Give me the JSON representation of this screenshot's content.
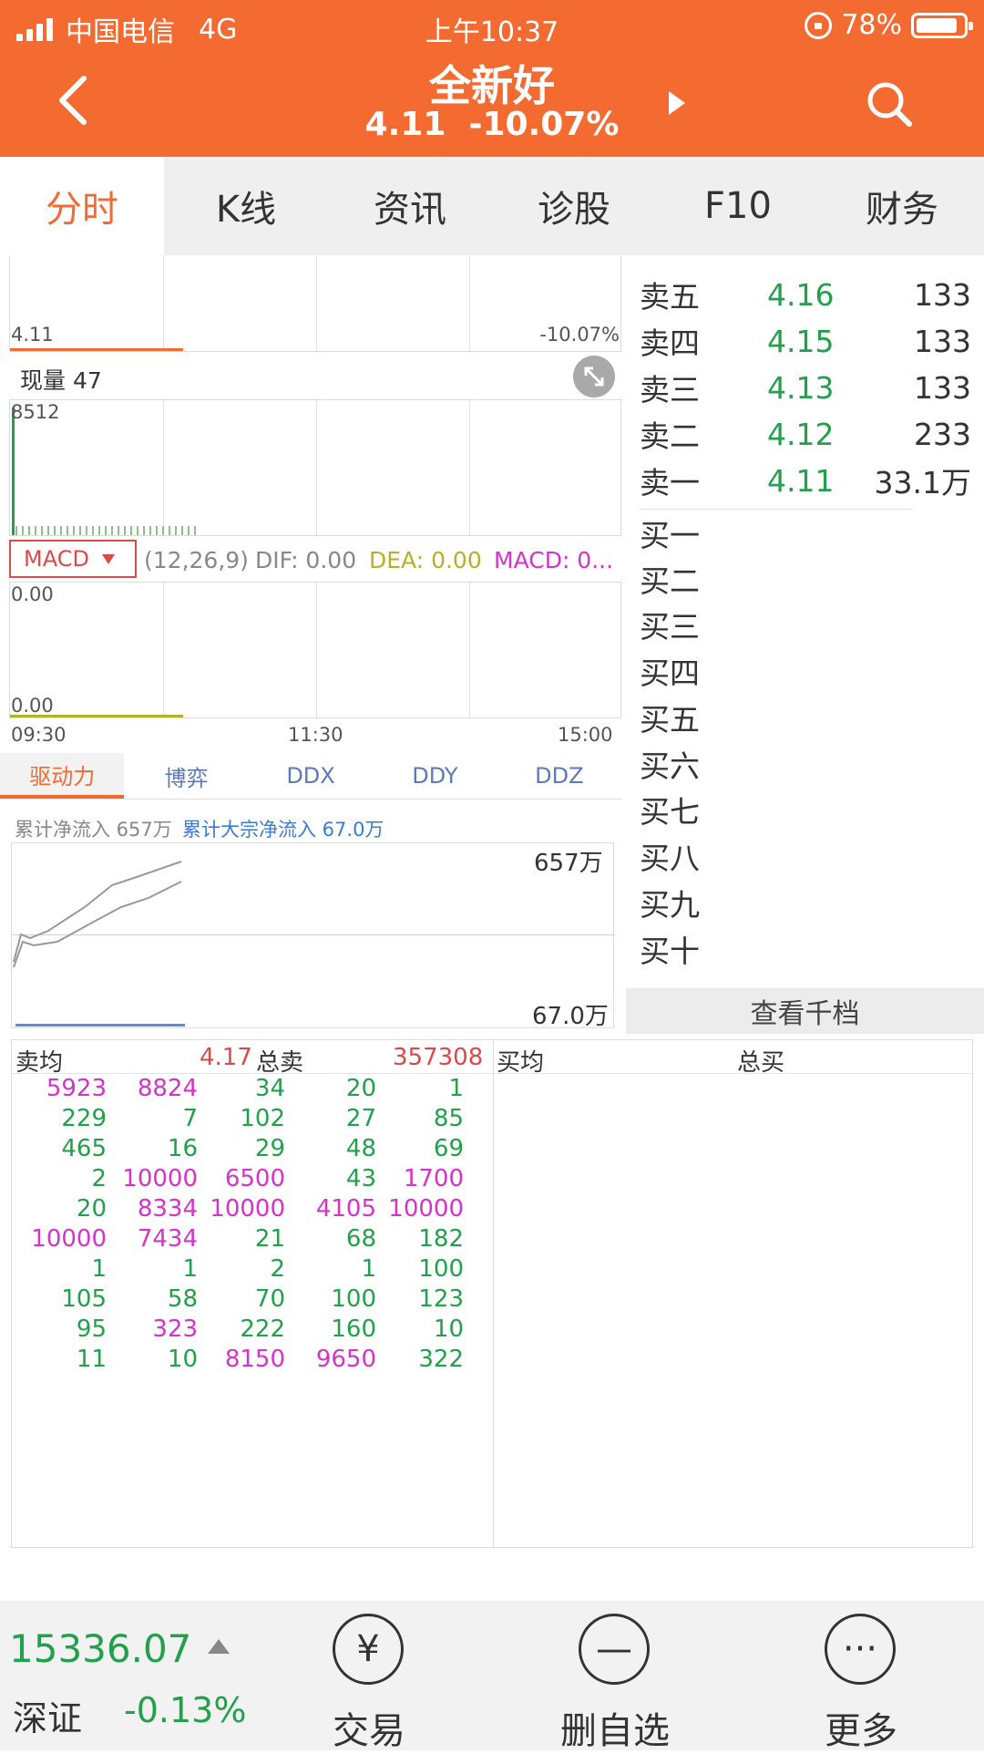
{
  "status_bar": {
    "carrier": "中国电信",
    "network": "4G",
    "time": "上午10:37",
    "battery": "78%"
  },
  "header": {
    "title": "全新好",
    "price": "4.11",
    "change_pct": "-10.07%",
    "accent_color": "#f46b32"
  },
  "tabs": [
    "分时",
    "K线",
    "资讯",
    "诊股",
    "F10",
    "财务"
  ],
  "price_chart": {
    "price_label": "4.11",
    "pct_label": "-10.07%"
  },
  "volume": {
    "label": "现量 47",
    "max_label": "8512"
  },
  "macd": {
    "selector": "MACD",
    "params": "(12,26,9)",
    "dif": "DIF: 0.00",
    "dea": "DEA: 0.00",
    "macd": "MACD: 0...",
    "top_label": "0.00",
    "bottom_label": "0.00"
  },
  "time_axis": [
    "09:30",
    "11:30",
    "15:00"
  ],
  "capital_tabs": [
    "驱动力",
    "博弈",
    "DDX",
    "DDY",
    "DDZ"
  ],
  "capital_flow": {
    "net_inflow": "累计净流入 657万",
    "block_inflow": "累计大宗净流入 67.0万",
    "top_label": "657万",
    "bottom_label": "67.0万"
  },
  "order_book": {
    "sells": [
      {
        "label": "卖五",
        "price": "4.16",
        "volume": "133"
      },
      {
        "label": "卖四",
        "price": "4.15",
        "volume": "133"
      },
      {
        "label": "卖三",
        "price": "4.13",
        "volume": "133"
      },
      {
        "label": "卖二",
        "price": "4.12",
        "volume": "233"
      },
      {
        "label": "卖一",
        "price": "4.11",
        "volume": "33.1万"
      }
    ],
    "buys": [
      "买一",
      "买二",
      "买三",
      "买四",
      "买五",
      "买六",
      "买七",
      "买八",
      "买九",
      "买十"
    ],
    "view_more": "查看千档"
  },
  "transactions": {
    "sell_avg_label": "卖均",
    "sell_avg": "4.17",
    "total_sell_label": "总卖",
    "total_sell": "357308",
    "buy_avg_label": "买均",
    "total_buy_label": "总买",
    "rows": [
      [
        {
          "v": "5923",
          "c": "m"
        },
        {
          "v": "8824",
          "c": "m"
        },
        {
          "v": "34",
          "c": "g"
        },
        {
          "v": "20",
          "c": "g"
        },
        {
          "v": "1",
          "c": "g"
        }
      ],
      [
        {
          "v": "229",
          "c": "g"
        },
        {
          "v": "7",
          "c": "g"
        },
        {
          "v": "102",
          "c": "g"
        },
        {
          "v": "27",
          "c": "g"
        },
        {
          "v": "85",
          "c": "g"
        }
      ],
      [
        {
          "v": "465",
          "c": "g"
        },
        {
          "v": "16",
          "c": "g"
        },
        {
          "v": "29",
          "c": "g"
        },
        {
          "v": "48",
          "c": "g"
        },
        {
          "v": "69",
          "c": "g"
        }
      ],
      [
        {
          "v": "2",
          "c": "g"
        },
        {
          "v": "10000",
          "c": "m"
        },
        {
          "v": "6500",
          "c": "m"
        },
        {
          "v": "43",
          "c": "g"
        },
        {
          "v": "1700",
          "c": "m"
        }
      ],
      [
        {
          "v": "20",
          "c": "g"
        },
        {
          "v": "8334",
          "c": "m"
        },
        {
          "v": "10000",
          "c": "m"
        },
        {
          "v": "4105",
          "c": "m"
        },
        {
          "v": "10000",
          "c": "m"
        }
      ],
      [
        {
          "v": "10000",
          "c": "m"
        },
        {
          "v": "7434",
          "c": "m"
        },
        {
          "v": "21",
          "c": "g"
        },
        {
          "v": "68",
          "c": "g"
        },
        {
          "v": "182",
          "c": "g"
        }
      ],
      [
        {
          "v": "1",
          "c": "g"
        },
        {
          "v": "1",
          "c": "g"
        },
        {
          "v": "2",
          "c": "g"
        },
        {
          "v": "1",
          "c": "g"
        },
        {
          "v": "100",
          "c": "g"
        }
      ],
      [
        {
          "v": "105",
          "c": "g"
        },
        {
          "v": "58",
          "c": "g"
        },
        {
          "v": "70",
          "c": "g"
        },
        {
          "v": "100",
          "c": "g"
        },
        {
          "v": "123",
          "c": "g"
        }
      ],
      [
        {
          "v": "95",
          "c": "g"
        },
        {
          "v": "323",
          "c": "m"
        },
        {
          "v": "222",
          "c": "g"
        },
        {
          "v": "160",
          "c": "g"
        },
        {
          "v": "10",
          "c": "g"
        }
      ],
      [
        {
          "v": "11",
          "c": "g"
        },
        {
          "v": "10",
          "c": "g"
        },
        {
          "v": "8150",
          "c": "m"
        },
        {
          "v": "9650",
          "c": "m"
        },
        {
          "v": "322",
          "c": "g"
        }
      ]
    ]
  },
  "bottom_bar": {
    "index_value": "15336.07",
    "index_name": "深证",
    "index_change": "-0.13%",
    "buttons": [
      {
        "icon": "¥",
        "label": "交易"
      },
      {
        "icon": "—",
        "label": "删自选"
      },
      {
        "icon": "···",
        "label": "更多"
      }
    ]
  },
  "colors": {
    "green": "#23a04b",
    "magenta": "#d633c9",
    "red": "#d94b4b",
    "blue": "#5a7bb5",
    "olive": "#b3b32a"
  }
}
